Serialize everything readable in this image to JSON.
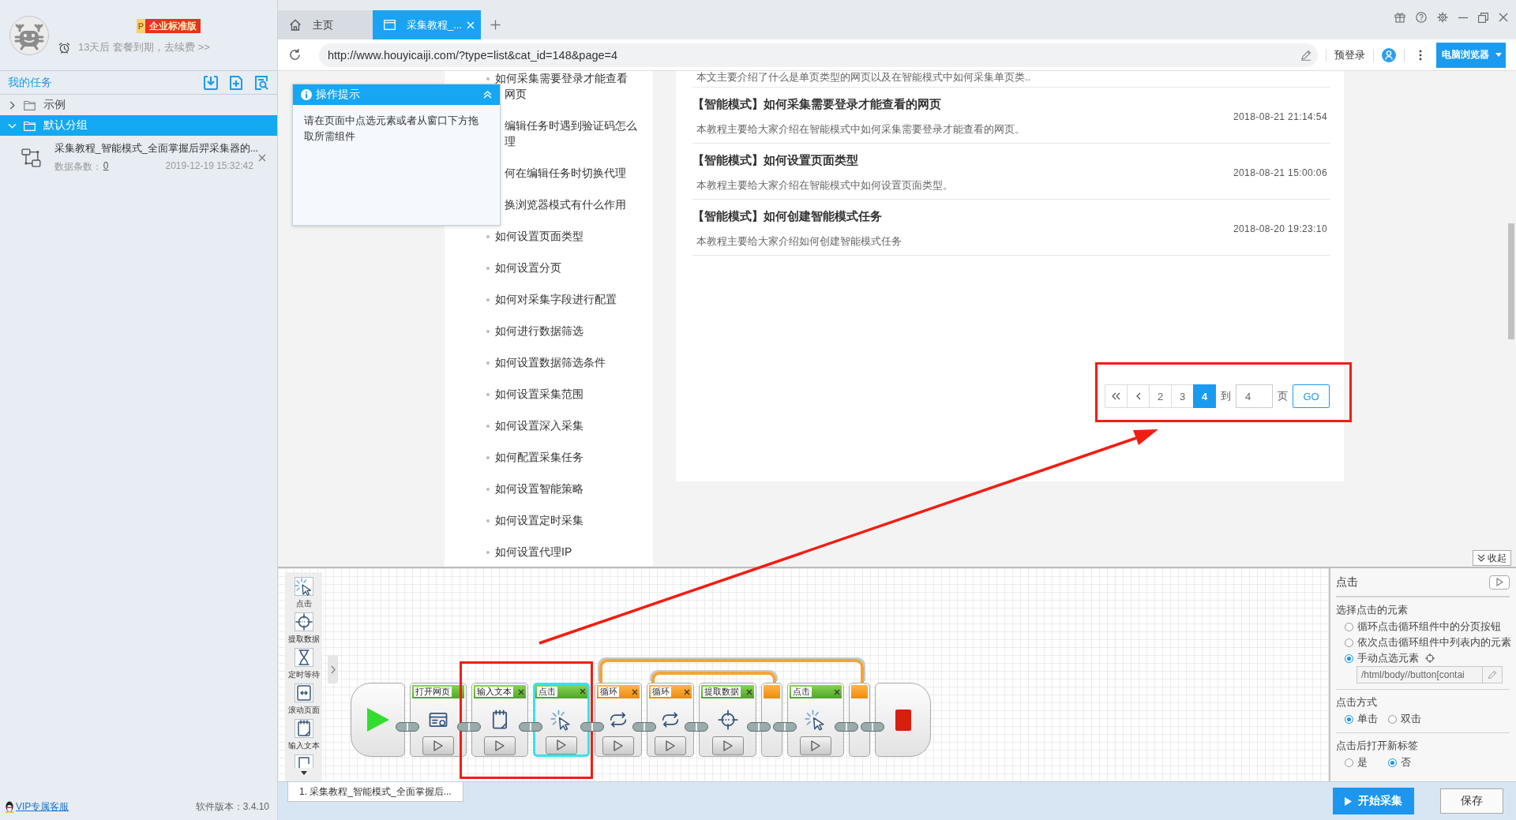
{
  "sidebar": {
    "profile": {
      "badge_letter": "P",
      "badge": "企业标准版",
      "notice": "13天后 套餐到期，去续费 >>"
    },
    "header": "我的任务",
    "tree": [
      {
        "label": "示例",
        "expanded": false,
        "selected": false
      },
      {
        "label": "默认分组",
        "expanded": true,
        "selected": true,
        "children": [
          {
            "title": "采集教程_智能模式_全面掌握后羿采集器的...",
            "count_label": "数据条数：",
            "count": "0",
            "time": "2019-12-19 15:32:42"
          }
        ]
      }
    ],
    "footer": {
      "link": "VIP专属客服",
      "version": "软件版本：3.4.10"
    }
  },
  "tabs": [
    {
      "kind": "home",
      "label": "主页",
      "selected": false,
      "closable": false
    },
    {
      "kind": "page",
      "label": "采集教程_...",
      "selected": true,
      "closable": true
    }
  ],
  "address_bar": {
    "url": "http://www.houyicaiji.com/?type=list&cat_id=148&page=4",
    "login": "预登录",
    "mode": "电脑浏览器"
  },
  "browser": {
    "tooltip": {
      "title": "操作提示",
      "text": "请在页面中点选元素或者从窗口下方拖取所需组件"
    },
    "article_links": [
      {
        "lines": [
          {
            "text": "如何采集需要登录才能查看",
            "clipped": false
          },
          {
            "text": "网页",
            "clipped": true
          }
        ]
      },
      {
        "lines": [
          {
            "text": "编辑任务时遇到验证码怎么",
            "clipped": true
          },
          {
            "text": "理",
            "clipped": true
          }
        ]
      },
      {
        "lines": [
          {
            "text": "何在编辑任务时切换代理",
            "clipped": true
          }
        ]
      },
      {
        "lines": [
          {
            "text": "换浏览器模式有什么作用",
            "clipped": true
          }
        ]
      },
      {
        "lines": [
          {
            "text": "如何设置页面类型",
            "clipped": false
          }
        ]
      },
      {
        "lines": [
          {
            "text": "如何设置分页",
            "clipped": false
          }
        ]
      },
      {
        "lines": [
          {
            "text": "如何对采集字段进行配置",
            "clipped": false
          }
        ]
      },
      {
        "lines": [
          {
            "text": "如何进行数据筛选",
            "clipped": false
          }
        ]
      },
      {
        "lines": [
          {
            "text": "如何设置数据筛选条件",
            "clipped": false
          }
        ]
      },
      {
        "lines": [
          {
            "text": "如何设置采集范围",
            "clipped": false
          }
        ]
      },
      {
        "lines": [
          {
            "text": "如何设置深入采集",
            "clipped": false
          }
        ]
      },
      {
        "lines": [
          {
            "text": "如何配置采集任务",
            "clipped": false
          }
        ]
      },
      {
        "lines": [
          {
            "text": "如何设置智能策略",
            "clipped": false
          }
        ]
      },
      {
        "lines": [
          {
            "text": "如何设置定时采集",
            "clipped": false
          }
        ]
      },
      {
        "lines": [
          {
            "text": "如何设置代理IP",
            "clipped": false
          }
        ]
      }
    ],
    "articles": {
      "lead": "本文主要介绍了什么是单页类型的网页以及在智能模式中如何采集单页类..",
      "items": [
        {
          "title": "【智能模式】如何采集需要登录才能查看的网页",
          "date": "2018-08-21 21:14:54",
          "desc": "本教程主要给大家介绍在智能模式中如何采集需要登录才能查看的网页。"
        },
        {
          "title": "【智能模式】如何设置页面类型",
          "date": "2018-08-21 15:00:06",
          "desc": "本教程主要给大家介绍在智能模式中如何设置页面类型。"
        },
        {
          "title": "【智能模式】如何创建智能模式任务",
          "date": "2018-08-20 19:23:10",
          "desc": "本教程主要给大家介绍如何创建智能模式任务"
        }
      ]
    },
    "pagination": {
      "pages": [
        {
          "label": "2",
          "selected": false
        },
        {
          "label": "3",
          "selected": false
        },
        {
          "label": "4",
          "selected": true
        }
      ],
      "jump_label": "到",
      "value": "4",
      "unit": "页",
      "go": "GO"
    }
  },
  "collapse_button": "收起",
  "palette": [
    {
      "kind": "click",
      "label": "点击"
    },
    {
      "kind": "extract",
      "label": "提取数据"
    },
    {
      "kind": "wait",
      "label": "定时等待"
    },
    {
      "kind": "scroll",
      "label": "滚动页面"
    },
    {
      "kind": "input_text",
      "label": "输入文本"
    }
  ],
  "flow": {
    "steps": [
      {
        "kind": "start"
      },
      {
        "kind": "open_page",
        "label": "打开网页",
        "removable": false,
        "selected": false
      },
      {
        "kind": "input_text",
        "label": "输入文本",
        "removable": true,
        "selected": false
      },
      {
        "kind": "click",
        "label": "点击",
        "removable": true,
        "selected": true
      },
      {
        "kind": "loop",
        "label": "循环",
        "removable": true,
        "selected": false,
        "children": [
          {
            "kind": "loop",
            "label": "循环",
            "removable": true,
            "selected": false,
            "children": [
              {
                "kind": "extract",
                "label": "提取数据",
                "removable": true,
                "selected": false
              }
            ]
          },
          {
            "kind": "click",
            "label": "点击",
            "removable": true,
            "selected": false
          }
        ]
      },
      {
        "kind": "end"
      }
    ]
  },
  "task_tab": "1. 采集教程_智能模式_全面掌握后...",
  "properties": {
    "title": "点击",
    "sections": [
      {
        "kind": "stack",
        "title": "选择点击的元素",
        "options": [
          {
            "label": "循环点击循环组件中的分页按钮",
            "selected": false
          },
          {
            "label": "依次点击循环组件中列表内的元素",
            "selected": false
          },
          {
            "label": "手动点选元素",
            "selected": true,
            "xpath": "/html/body//button[contai"
          }
        ]
      },
      {
        "kind": "inline",
        "title": "点击方式",
        "options": [
          {
            "label": "单击",
            "selected": true
          },
          {
            "label": "双击",
            "selected": false
          }
        ]
      },
      {
        "kind": "inline",
        "title": "点击后打开新标签",
        "options": [
          {
            "label": "是",
            "selected": false
          },
          {
            "label": "否",
            "selected": true
          }
        ]
      }
    ]
  },
  "actions": {
    "start": "开始采集",
    "save": "保存"
  }
}
